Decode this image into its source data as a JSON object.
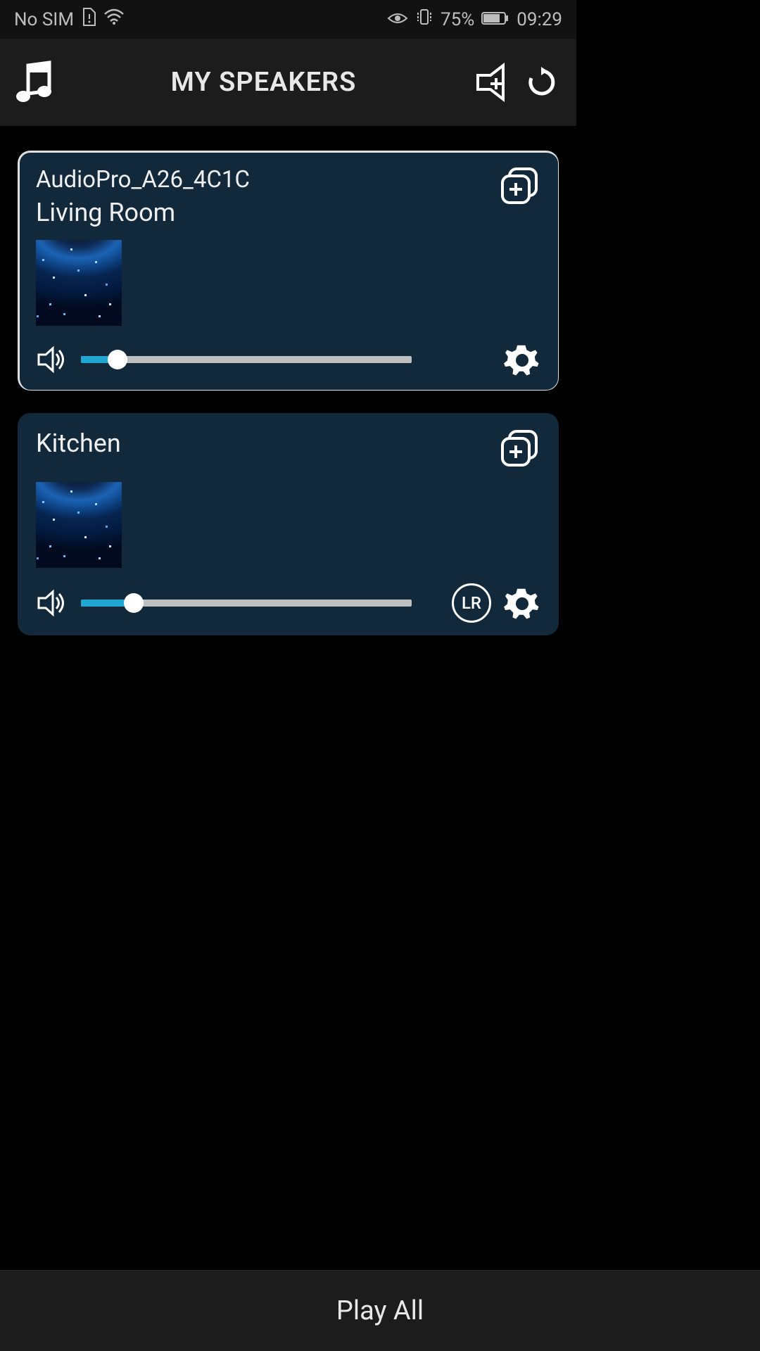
{
  "status": {
    "sim": "No SIM",
    "battery_pct": "75%",
    "time": "09:29"
  },
  "header": {
    "title": "MY SPEAKERS"
  },
  "speakers": [
    {
      "device_name": "AudioPro_A26_4C1C",
      "room_name": "Living Room",
      "volume_pct": 11,
      "selected": true,
      "has_lr": false
    },
    {
      "device_name": "",
      "room_name": "Kitchen",
      "volume_pct": 16,
      "selected": false,
      "has_lr": true,
      "lr_label": "LR"
    }
  ],
  "footer": {
    "play_all": "Play All"
  },
  "colors": {
    "card_bg": "#12293b",
    "accent": "#1fa6d1"
  }
}
